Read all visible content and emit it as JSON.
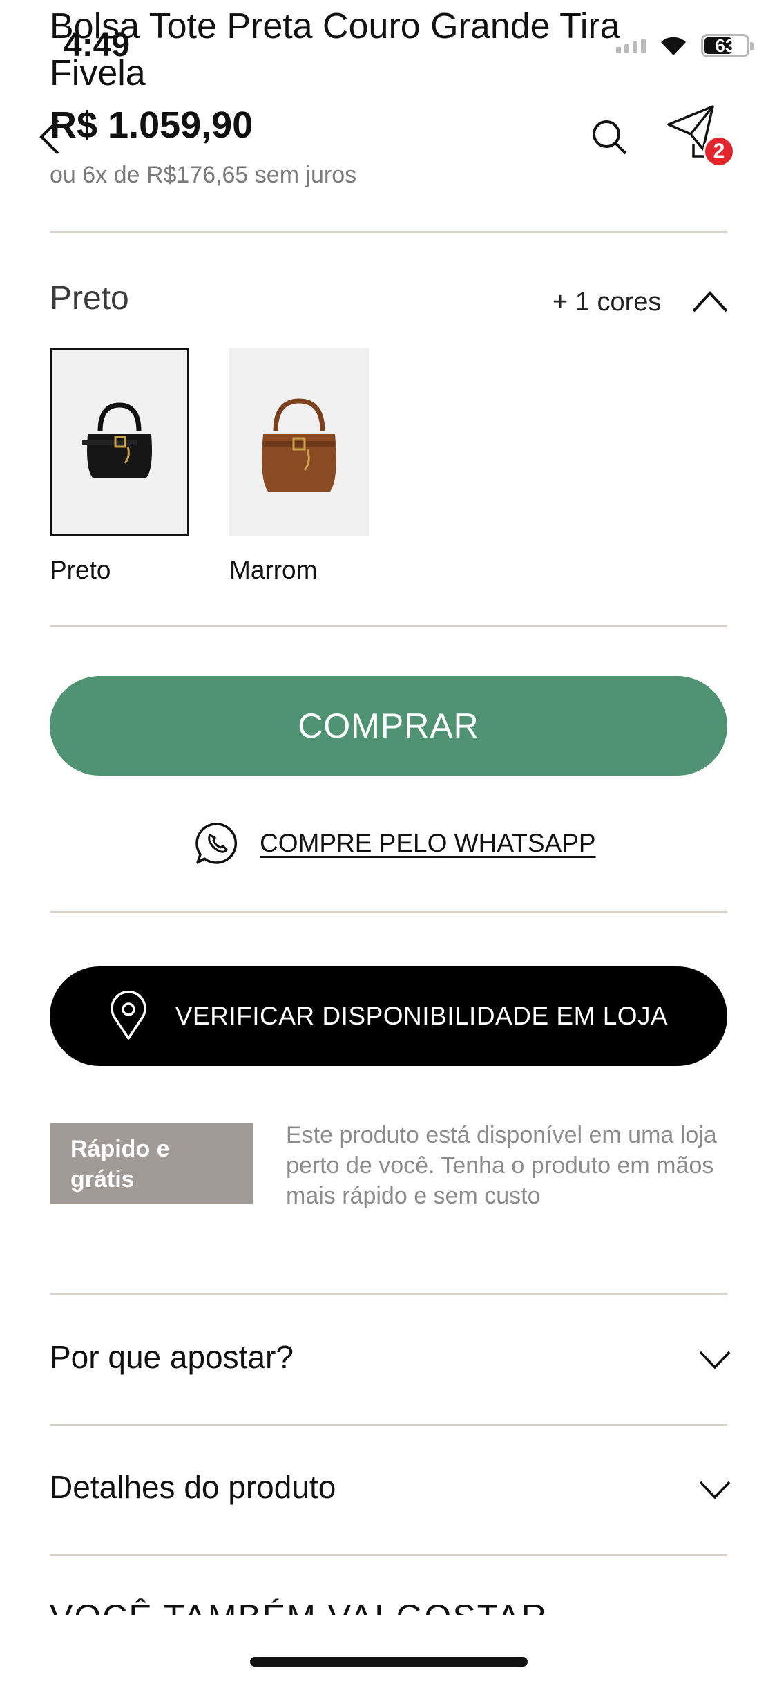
{
  "status_bar": {
    "time": "4:49",
    "battery": "63",
    "battery_level": 0.63
  },
  "header": {
    "back_icon": "chevron-left-icon",
    "search_icon": "search-icon",
    "bag_icon": "shopping-bag-icon",
    "cart_count": "2"
  },
  "product": {
    "title": "Bolsa Tote Preta Couro Grande Tira Fivela",
    "price": "R$ 1.059,90",
    "installments": "ou 6x de R$176,65 sem juros"
  },
  "colors": {
    "selected_name": "Preto",
    "more_label": "+ 1 cores",
    "options": [
      {
        "label": "Preto",
        "swatch_color": "#1a1a1a",
        "selected": true
      },
      {
        "label": "Marrom",
        "swatch_color": "#8a4a24",
        "selected": false
      }
    ]
  },
  "actions": {
    "buy_label": "COMPRAR",
    "buy_color": "#4f9373",
    "whatsapp_label": "COMPRE PELO WHATSAPP",
    "store_label": "VERIFICAR DISPONIBILIDADE EM LOJA"
  },
  "promo": {
    "badge": "Rápido e grátis",
    "text": "Este produto está disponível em uma loja perto de você. Tenha o produto em mãos mais rápido e sem custo"
  },
  "accordions": [
    {
      "label": "Por que apostar?"
    },
    {
      "label": "Detalhes do produto"
    }
  ],
  "recommendations": {
    "title": "VOCÊ TAMBÉM VAI GOSTAR"
  }
}
